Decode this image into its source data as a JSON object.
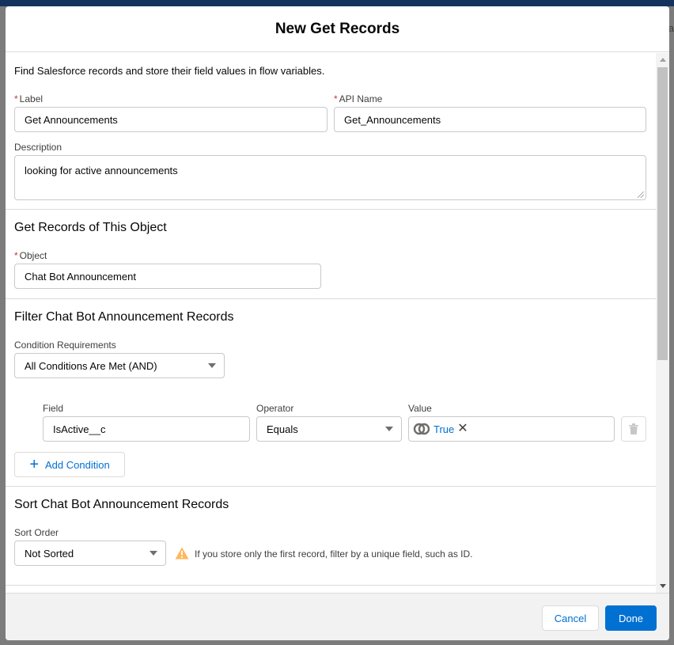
{
  "background": {
    "edge_text": "a"
  },
  "modal": {
    "title": "New Get Records",
    "intro": "Find Salesforce records and store their field values in flow variables.",
    "label_field": {
      "required_mark": "*",
      "label": "Label",
      "value": "Get Announcements"
    },
    "api_name_field": {
      "required_mark": "*",
      "label": "API Name",
      "value": "Get_Announcements"
    },
    "description_field": {
      "label": "Description",
      "value": "looking for active announcements"
    },
    "object_section": {
      "title": "Get Records of This Object",
      "object_field": {
        "required_mark": "*",
        "label": "Object",
        "value": "Chat Bot Announcement"
      }
    },
    "filter_section": {
      "title": "Filter Chat Bot Announcement Records",
      "condition_requirements": {
        "label": "Condition Requirements",
        "value": "All Conditions Are Met (AND)"
      },
      "condition": {
        "field_label": "Field",
        "field_value": "IsActive__c",
        "operator_label": "Operator",
        "operator_value": "Equals",
        "value_label": "Value",
        "value_pill": "True"
      },
      "add_condition": "Add Condition"
    },
    "sort_section": {
      "title": "Sort Chat Bot Announcement Records",
      "sort_order": {
        "label": "Sort Order",
        "value": "Not Sorted"
      },
      "warning": "If you store only the first record, filter by a unique field, such as ID."
    },
    "footer": {
      "cancel": "Cancel",
      "done": "Done"
    }
  },
  "colors": {
    "brand": "#0070d2",
    "required": "#c23934",
    "warning": "#ffb75d",
    "border": "#c9c9c9"
  },
  "icons": [
    "global-value-icon",
    "close-icon",
    "delete-icon",
    "add-icon",
    "warning-icon",
    "chevron-down-icon"
  ]
}
